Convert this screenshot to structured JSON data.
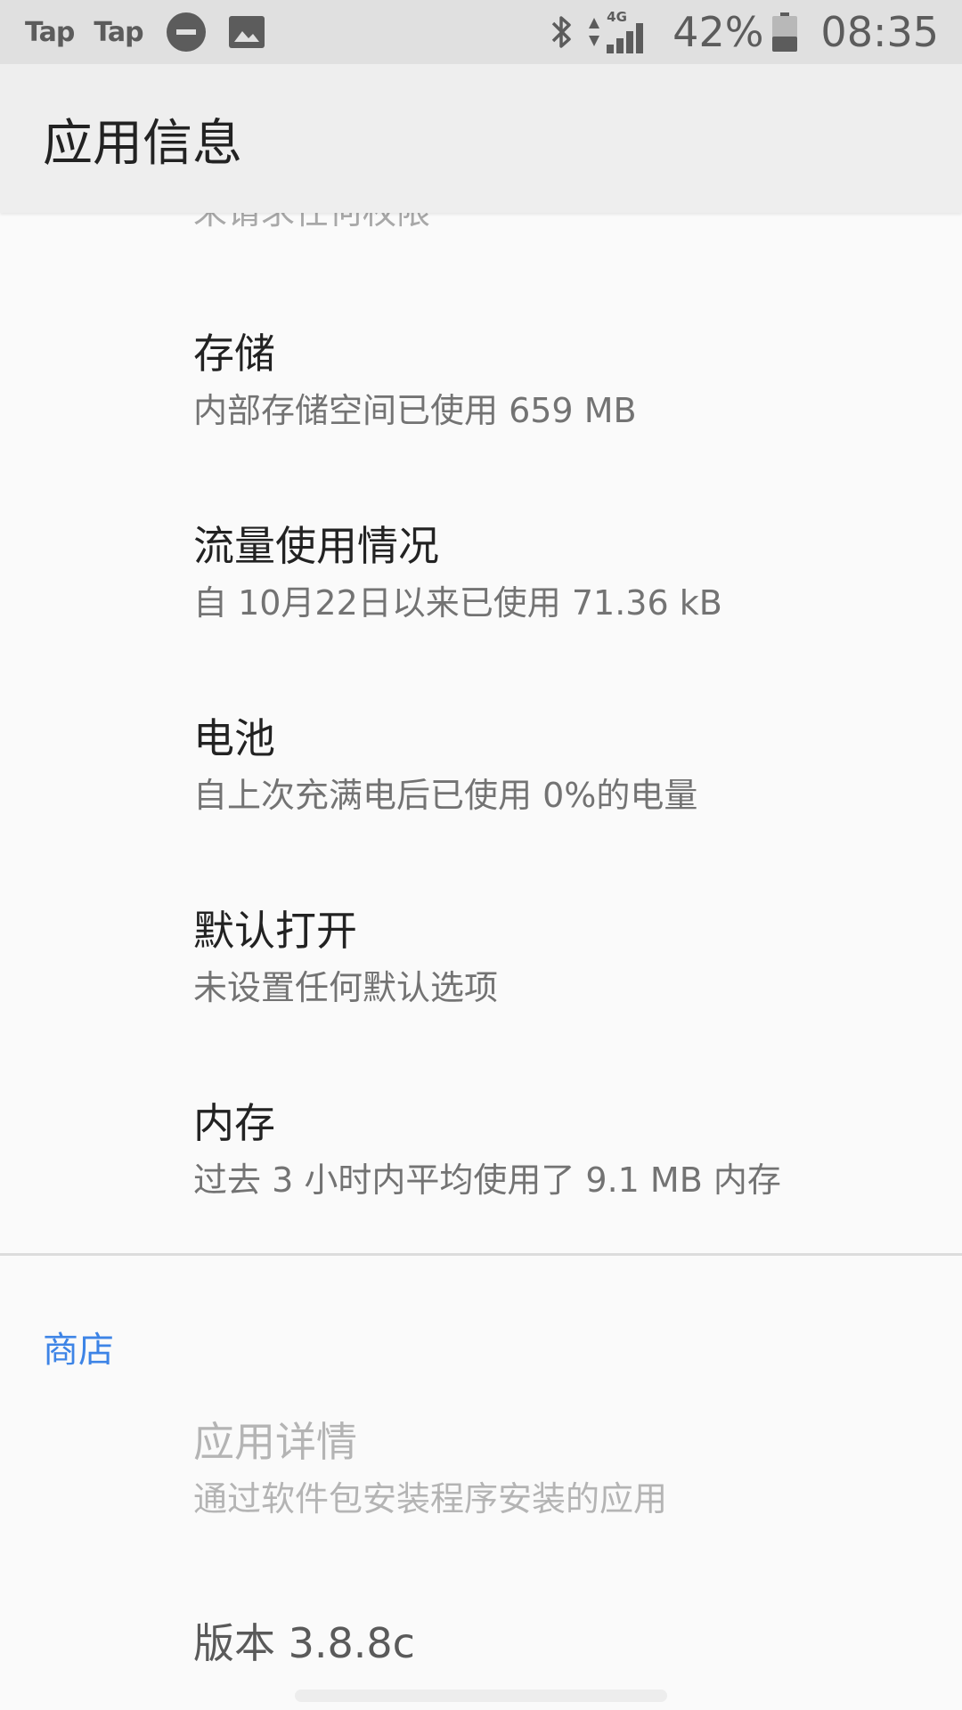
{
  "status_bar": {
    "notification_labels": [
      "Tap",
      "Tap"
    ],
    "icons": [
      "do-not-disturb-icon",
      "image-icon",
      "bluetooth-icon",
      "mobile-data-icon",
      "cell-signal-icon",
      "battery-icon"
    ],
    "network_type": "4G",
    "battery_percent": "42%",
    "battery_level": 0.42,
    "time": "08:35"
  },
  "app_bar": {
    "title": "应用信息"
  },
  "settings": {
    "partial_item_summary": "未请求任何权限",
    "items": [
      {
        "title": "存储",
        "summary": "内部存储空间已使用 659 MB"
      },
      {
        "title": "流量使用情况",
        "summary": "自 10月22日以来已使用 71.36 kB"
      },
      {
        "title": "电池",
        "summary": "自上次充满电后已使用 0%的电量"
      },
      {
        "title": "默认打开",
        "summary": "未设置任何默认选项"
      },
      {
        "title": "内存",
        "summary": "过去 3 小时内平均使用了 9.1 MB 内存"
      }
    ]
  },
  "store_section": {
    "header": "商店",
    "app_details": {
      "title": "应用详情",
      "summary": "通过软件包安装程序安装的应用"
    },
    "version": "版本 3.8.8c"
  },
  "colors": {
    "accent": "#3d84e6",
    "status_bar_bg": "#e0e0e0",
    "app_bar_bg": "#eeeeee",
    "page_bg": "#fafafa"
  }
}
